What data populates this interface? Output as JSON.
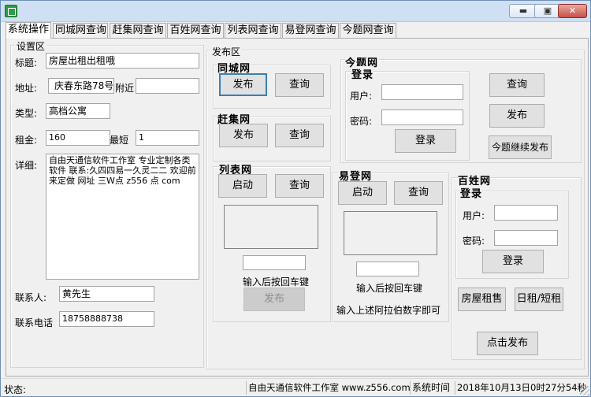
{
  "window": {
    "minimize": "▬",
    "maximize": "▣",
    "close": "✕"
  },
  "tabs": [
    "系统操作",
    "同城网查询",
    "赶集网查询",
    "百姓网查询",
    "列表网查询",
    "易登网查询",
    "今题网查询"
  ],
  "settings": {
    "group_title": "设置区",
    "title_label": "标题:",
    "title_value": "房屋出租出租哦",
    "address_label": "地址:",
    "address_value": "庆春东路78号",
    "nearby_label": "附近",
    "nearby_value": "",
    "type_label": "类型:",
    "type_value": "高档公寓",
    "rent_label": "租金:",
    "rent_value": "160",
    "min_label": "最短",
    "min_value": "1",
    "detail_label": "详细:",
    "detail_value": "自由天通信软件工作室 专业定制各类软件 联系:久四四易一久灵二二 欢迎前来定做 网址 三W点 z556 点 com",
    "contact_label": "联系人:",
    "contact_value": "黄先生",
    "phone_label": "联系电话",
    "phone_value": "18758888738"
  },
  "publish": {
    "group_title": "发布区",
    "tongcheng": {
      "title": "同城网",
      "publish": "发布",
      "query": "查询"
    },
    "ganji": {
      "title": "赶集网",
      "publish": "发布",
      "query": "查询"
    },
    "liebiao": {
      "title": "列表网",
      "start": "启动",
      "query": "查询",
      "hint": "输入后按回车键",
      "publish": "发布"
    },
    "jinti": {
      "title": "今题网",
      "login_title": "登录",
      "user_label": "用户:",
      "user_value": "",
      "password_label": "密码:",
      "password_value": "",
      "login": "登录",
      "query": "查询",
      "publish": "发布",
      "continue": "今题继续发布"
    },
    "yideng": {
      "title": "易登网",
      "start": "启动",
      "query": "查询",
      "hint": "输入后按回车键",
      "hint2": "输入上述阿拉伯数字即可"
    },
    "baixing": {
      "title": "百姓网",
      "login_title": "登录",
      "user_label": "用户:",
      "user_value": "",
      "password_label": "密码:",
      "password_value": "",
      "login": "登录",
      "house_rent": "房屋租售",
      "daily_short": "日租/短租",
      "click_publish": "点击发布"
    }
  },
  "statusbar": {
    "state_label": "状态:",
    "company": "自由天通信软件工作室 www.z556.com",
    "time_label": "系统时间",
    "time_value": "2018年10月13日0时27分54秒"
  }
}
